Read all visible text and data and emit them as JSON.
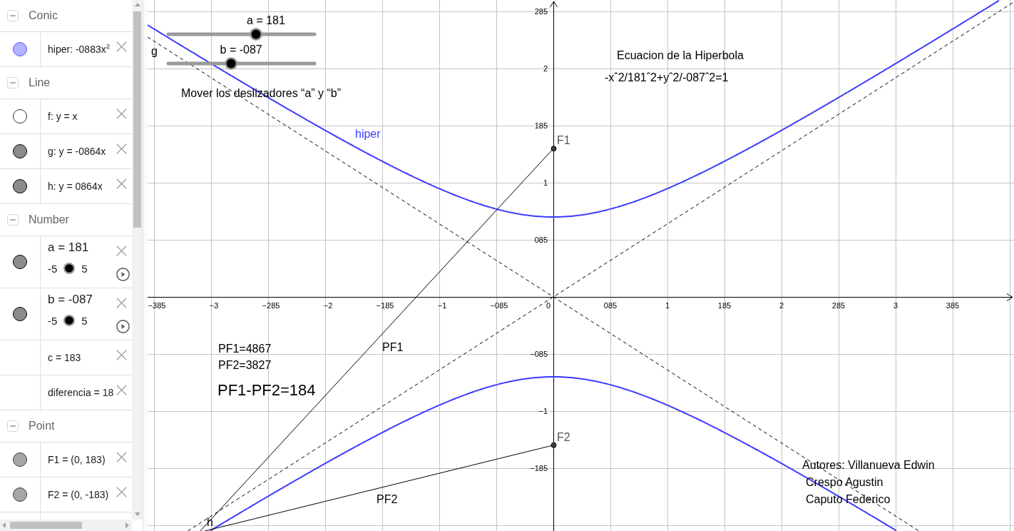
{
  "algebra": {
    "groups": [
      {
        "title": "Conic",
        "expanded": true,
        "items": [
          {
            "kind": "object",
            "text": "hiper: -0883x$^{2}$",
            "visible": true,
            "color": "#b3b3ff"
          }
        ]
      },
      {
        "title": "Line",
        "expanded": true,
        "items": [
          {
            "kind": "object",
            "text": "f: y = x",
            "visible": false
          },
          {
            "kind": "object",
            "text": "g: y = -0864x",
            "visible": true,
            "color": "#8c8c8c"
          },
          {
            "kind": "object",
            "text": "h: y = 0864x",
            "visible": true,
            "color": "#8c8c8c"
          }
        ]
      },
      {
        "title": "Number",
        "expanded": true,
        "items": [
          {
            "kind": "slider",
            "text": "a = 181",
            "min": "-5",
            "max": "5",
            "visible": true,
            "color": "#8c8c8c"
          },
          {
            "kind": "slider",
            "text": "b = -087",
            "min": "-5",
            "max": "5",
            "visible": true,
            "color": "#8c8c8c"
          },
          {
            "kind": "object",
            "text": "c = 183"
          },
          {
            "kind": "object",
            "text": "diferencia = 18"
          }
        ]
      },
      {
        "title": "Point",
        "expanded": true,
        "items": [
          {
            "kind": "object",
            "text": "F1 = (0, 183)",
            "visible": true,
            "color": "#a6a6a6"
          },
          {
            "kind": "object",
            "text": "F2 = (0, -183)",
            "visible": true,
            "color": "#a6a6a6"
          }
        ]
      }
    ]
  },
  "graphics": {
    "sliders": [
      {
        "label": "a = 181",
        "level": 0.6
      },
      {
        "label": "b = -087",
        "level": 0.43
      }
    ],
    "x_axis_labels": [
      "−385",
      "−3",
      "−285",
      "−2",
      "−185",
      "−1",
      "−085",
      "0",
      "085",
      "1",
      "185",
      "2",
      "285",
      "3",
      "385"
    ],
    "y_axis_labels": [
      "285",
      "2",
      "185",
      "1",
      "085",
      "−085",
      "−1",
      "−185"
    ],
    "hyperbola_label": "hiper",
    "line_labels": [
      "g",
      "h"
    ],
    "point_labels": [
      "F1",
      "F2"
    ],
    "segment_labels": [
      "PF1",
      "PF2"
    ],
    "instruction": "Mover los deslizadores “a” y “b”",
    "equation_title": "Ecuacion de la Hiperbola",
    "equation": "-xˆ2/181ˆ2+yˆ2/-087ˆ2=1",
    "measurements": [
      "PF1=4867",
      "PF2=3827"
    ],
    "difference": "PF1-PF2=184",
    "authors": [
      "Autores: Villanueva Edwin",
      "Crespo Agustin",
      "Caputo Federico"
    ]
  }
}
